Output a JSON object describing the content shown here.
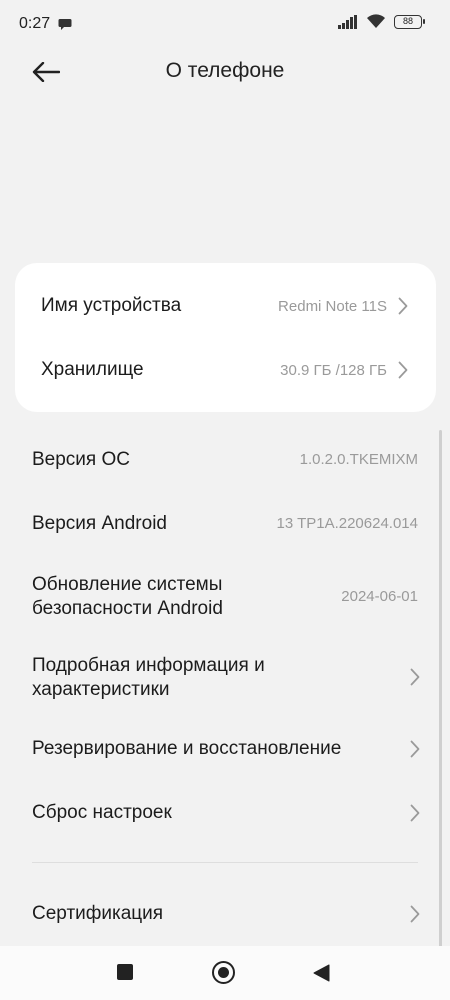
{
  "status_bar": {
    "time": "0:27",
    "battery": "88"
  },
  "header": {
    "title": "О телефоне"
  },
  "card": {
    "items": [
      {
        "label": "Имя устройства",
        "value": "Redmi Note 11S"
      },
      {
        "label": "Хранилище",
        "value": "30.9 ГБ /128 ГБ"
      }
    ]
  },
  "list": {
    "os_version": {
      "label": "Версия ОС",
      "value": "1.0.2.0.TKEMIXM"
    },
    "android_version": {
      "label": "Версия Android",
      "value": "13 TP1A.220624.014"
    },
    "security_update": {
      "label_line1": "Обновление системы",
      "label_line2": "безопасности Android",
      "value": "2024-06-01"
    },
    "details": {
      "label_line1": "Подробная информация и",
      "label_line2": "характеристики"
    },
    "backup": {
      "label": "Резервирование и восстановление"
    },
    "reset": {
      "label": "Сброс настроек"
    },
    "certification": {
      "label": "Сертификация"
    }
  },
  "colors": {
    "background": "#f2f2f2",
    "card": "#ffffff",
    "secondary_text": "#9a9a9a"
  }
}
